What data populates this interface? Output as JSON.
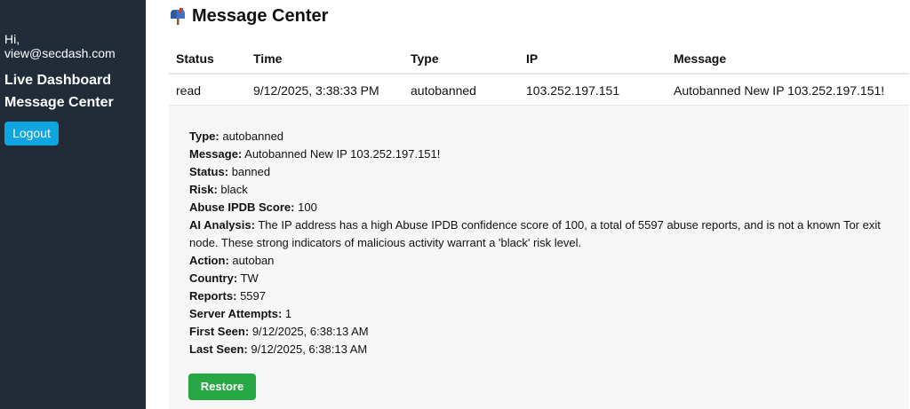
{
  "sidebar": {
    "greeting_line1": "Hi,",
    "greeting_line2": "view@secdash.com",
    "nav": [
      {
        "label": "Live Dashboard"
      },
      {
        "label": "Message Center"
      }
    ],
    "logout_label": "Logout"
  },
  "page": {
    "title": "Message Center",
    "title_icon": "mailbox-icon"
  },
  "table": {
    "headers": [
      "Status",
      "Time",
      "Type",
      "IP",
      "Message"
    ],
    "rows": [
      {
        "status": "read",
        "time": "9/12/2025, 3:38:33 PM",
        "type": "autobanned",
        "ip": "103.252.197.151",
        "message": "Autobanned New IP 103.252.197.151!"
      }
    ]
  },
  "details": {
    "fields": [
      {
        "label": "Type:",
        "value": "autobanned"
      },
      {
        "label": "Message:",
        "value": "Autobanned New IP 103.252.197.151!"
      },
      {
        "label": "Status:",
        "value": "banned"
      },
      {
        "label": "Risk:",
        "value": "black"
      },
      {
        "label": "Abuse IPDB Score:",
        "value": "100"
      },
      {
        "label": "AI Analysis:",
        "value": "The IP address has a high Abuse IPDB confidence score of 100, a total of 5597 abuse reports, and is not a known Tor exit node. These strong indicators of malicious activity warrant a 'black' risk level."
      },
      {
        "label": "Action:",
        "value": "autoban"
      },
      {
        "label": "Country:",
        "value": "TW"
      },
      {
        "label": "Reports:",
        "value": "5597"
      },
      {
        "label": "Server Attempts:",
        "value": "1"
      },
      {
        "label": "First Seen:",
        "value": "9/12/2025, 6:38:13 AM"
      },
      {
        "label": "Last Seen:",
        "value": "9/12/2025, 6:38:13 AM"
      }
    ],
    "restore_label": "Restore"
  },
  "colors": {
    "sidebar_bg": "#222b38",
    "logout_button": "#0ea5e0",
    "restore_button": "#28a745",
    "details_bg": "#f7f7f7"
  }
}
